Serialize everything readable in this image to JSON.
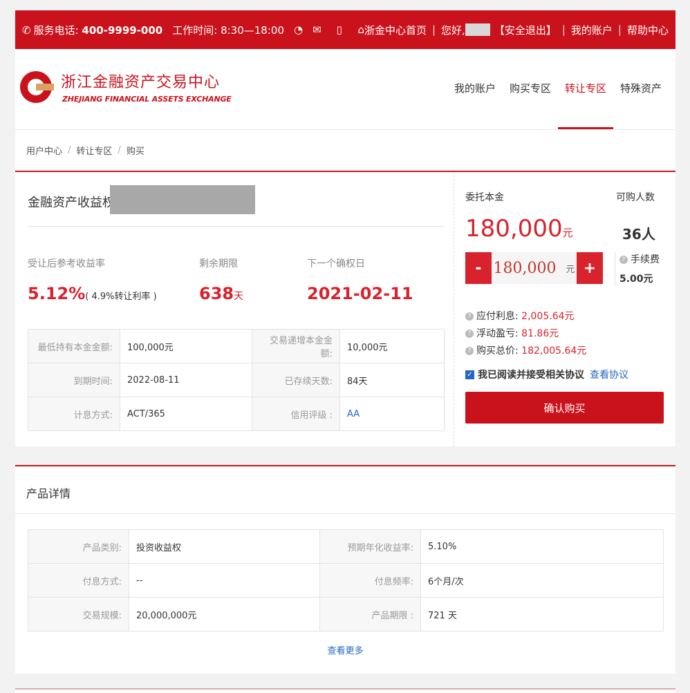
{
  "topbar": {
    "phone_label": "服务电话:",
    "phone": "400-9999-000",
    "hours": "工作时间: 8:30—18:00",
    "home": "浙金中心首页",
    "greeting": "您好,",
    "logout": "【安全退出】",
    "my_account": "我的账户",
    "help": "帮助中心"
  },
  "logo": {
    "cn": "浙江金融资产交易中心",
    "en": "ZHEJIANG FINANCIAL ASSETS EXCHANGE"
  },
  "nav": [
    "我的账户",
    "购买专区",
    "转让专区",
    "特殊资产"
  ],
  "breadcrumb": [
    "用户中心",
    "转让专区",
    "购买"
  ],
  "product": {
    "title": "金融资产收益权",
    "rate_label": "受让后参考收益率",
    "rate": "5.12%",
    "rate_sub": "( 4.9%转让利率 )",
    "term_label": "剩余期限",
    "term": "638",
    "term_unit": "天",
    "next_label": "下一个确权日",
    "next_date": "2021-02-11"
  },
  "info_table": [
    [
      "最低持有本金金额:",
      "100,000元",
      "交易递增本金金额:",
      "10,000元"
    ],
    [
      "到期时间:",
      "2022-08-11",
      "已存续天数:",
      "84天"
    ],
    [
      "计息方式:",
      "ACT/365",
      "信用评级 :",
      "AA"
    ]
  ],
  "order": {
    "principal_label": "委托本金",
    "buyers_label": "可购人数",
    "principal": "180,000",
    "principal_unit": "元",
    "buyers": "36人",
    "stepper_value": "180,000",
    "stepper_unit": "元",
    "fee_label": "手续费",
    "fee": "5.00元",
    "interest_label": "应付利息:",
    "interest": "2,005.64元",
    "pnl_label": "浮动盈亏:",
    "pnl": "81.86元",
    "total_label": "购买总价:",
    "total": "182,005.64元",
    "agree_text": "我已阅读并接受相关协议",
    "agree_link": "查看协议",
    "agree_checked": true,
    "confirm": "确认购买"
  },
  "detail": {
    "title": "产品详情",
    "rows": [
      [
        "产品类别:",
        "投资收益权",
        "预期年化收益率:",
        "5.10%"
      ],
      [
        "付息方式:",
        "--",
        "付息频率:",
        "6个月/次"
      ],
      [
        "交易规模:",
        "20,000,000元",
        "产品期限 :",
        "721 天"
      ]
    ],
    "more": "查看更多"
  },
  "colors": {
    "brand": "#c9121c",
    "link": "#2468c4"
  }
}
